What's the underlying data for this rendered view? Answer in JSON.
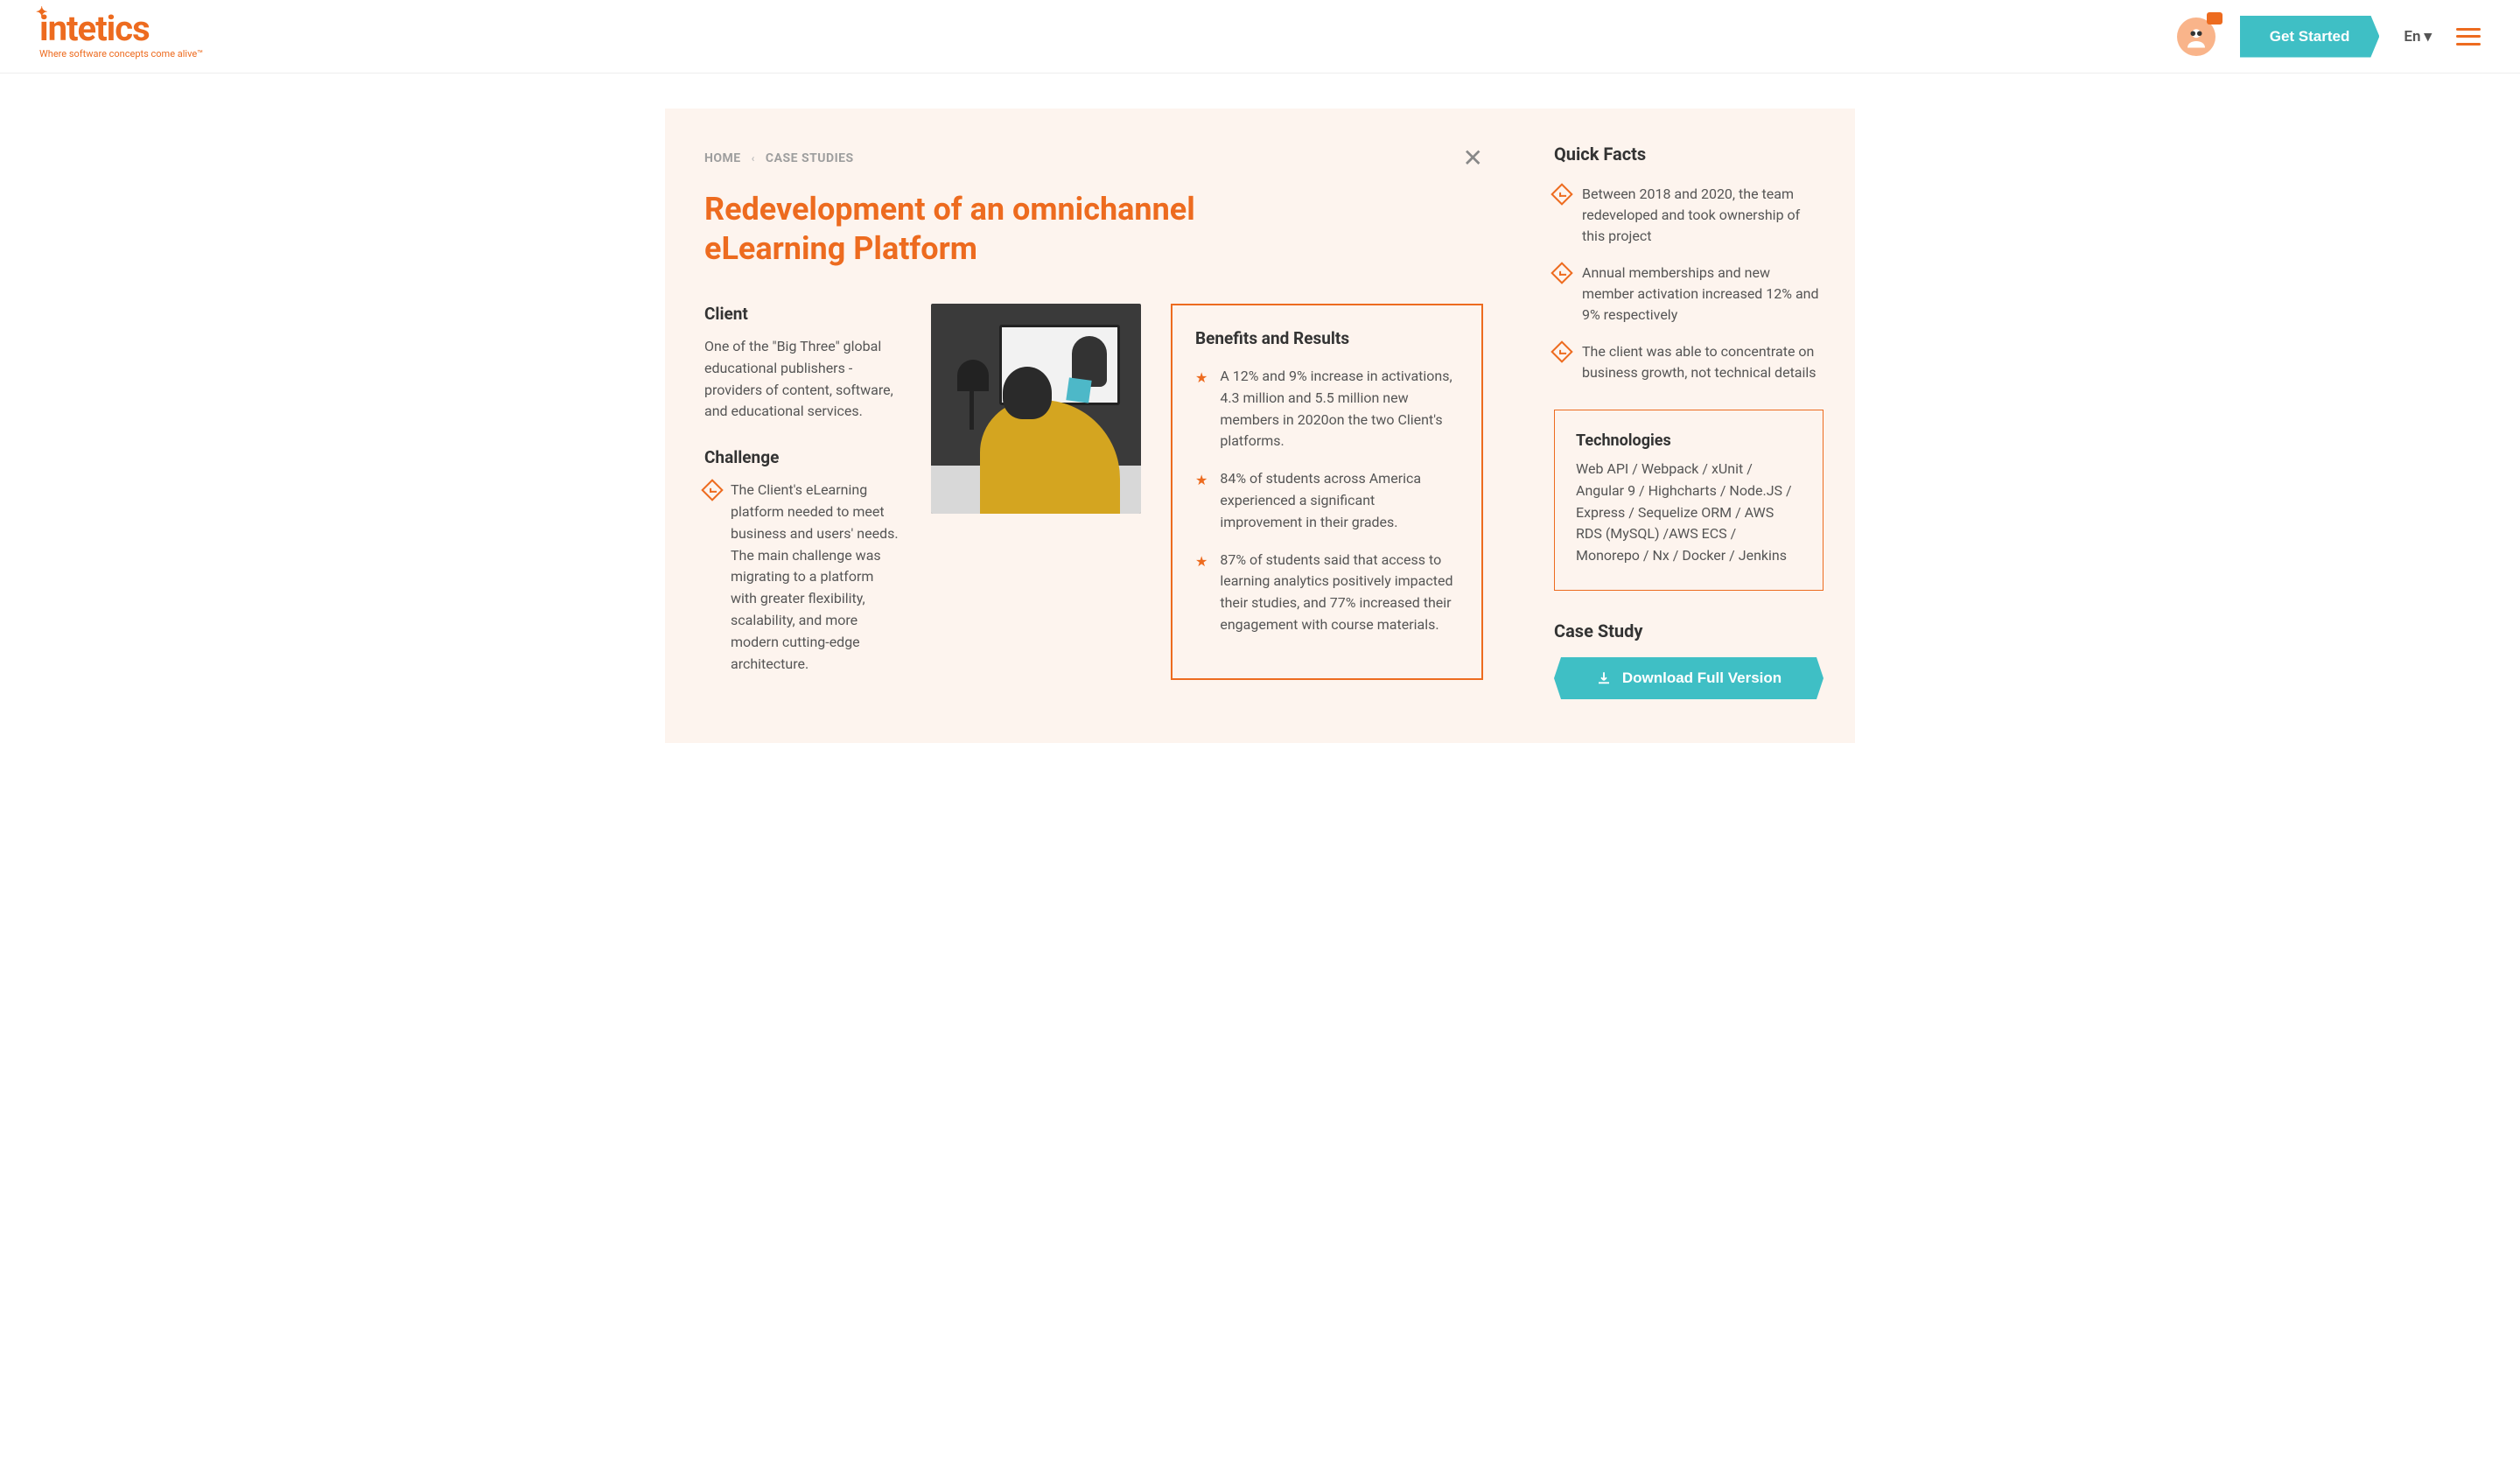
{
  "header": {
    "logo_text": "intetics",
    "logo_tagline": "Where software concepts come alive™",
    "cta": "Get Started",
    "lang": "En"
  },
  "breadcrumb": {
    "home": "HOME",
    "section": "CASE STUDIES"
  },
  "title": "Redevelopment of an omnichannel eLearning Platform",
  "client": {
    "heading": "Client",
    "body": "One of the \"Big Three\" global educational publishers - providers of content, software, and educational services."
  },
  "challenge": {
    "heading": "Challenge",
    "body": "The Client's eLearning platform needed to meet business and users' needs. The main challenge was migrating to a platform with greater flexibility, scalability, and more modern cutting-edge architecture."
  },
  "benefits": {
    "heading": "Benefits and Results",
    "items": [
      "A 12% and 9% increase in activations, 4.3 million and 5.5 million new members in 2020on the two Client's platforms.",
      "84% of students across America experienced a significant improvement in their grades.",
      "87% of students said that access to learning analytics positively impacted their studies, and 77% increased their engagement with course materials."
    ]
  },
  "quick_facts": {
    "heading": "Quick Facts",
    "items": [
      "Between 2018 and 2020, the team redeveloped and took ownership of this project",
      "Annual memberships and new member activation increased 12% and 9% respectively",
      "The client was able to concentrate on business growth, not technical details"
    ]
  },
  "tech": {
    "heading": "Technologies",
    "body": "Web API / Webpack / xUnit / Angular 9 / Highcharts / Node.JS / Express / Sequelize ORM / AWS RDS (MySQL) /AWS ECS / Monorepo / Nx / Docker / Jenkins"
  },
  "case_study": {
    "heading": "Case Study",
    "download": "Download Full Version"
  }
}
